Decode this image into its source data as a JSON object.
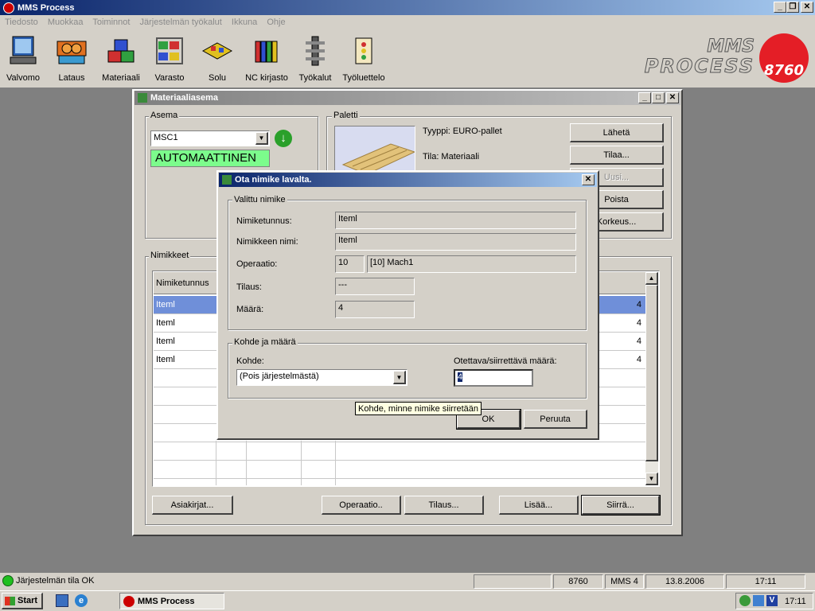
{
  "app": {
    "title": "MMS Process"
  },
  "menu": [
    "Tiedosto",
    "Muokkaa",
    "Toiminnot",
    "Järjestelmän työkalut",
    "Ikkuna",
    "Ohje"
  ],
  "toolbar": [
    {
      "label": "Valvomo",
      "icon": "monitor-icon"
    },
    {
      "label": "Lataus",
      "icon": "loading-station-icon"
    },
    {
      "label": "Materiaali",
      "icon": "material-boxes-icon"
    },
    {
      "label": "Varasto",
      "icon": "warehouse-shelf-icon"
    },
    {
      "label": "Solu",
      "icon": "cell-icon"
    },
    {
      "label": "NC kirjasto",
      "icon": "nc-library-icon"
    },
    {
      "label": "Työkalut",
      "icon": "tool-rack-icon"
    },
    {
      "label": "Työluettelo",
      "icon": "work-list-icon"
    }
  ],
  "logo": {
    "line1": "MMS",
    "line2": "PROCESS",
    "badge": "8760",
    "color": "#e41e26"
  },
  "station_window": {
    "title": "Materiaaliasema",
    "asema": {
      "label": "Asema",
      "station": "MSC1",
      "mode": "AUTOMAATTINEN"
    },
    "paletti": {
      "label": "Paletti",
      "type": "Tyyppi: EURO-pallet",
      "state": "Tila: Materiaali"
    },
    "buttons": {
      "send": "Lähetä",
      "order": "Tilaa...",
      "new": "Uusi...",
      "remove": "Poista",
      "height": "Korkeus..."
    },
    "nimikkeet": {
      "label": "Nimikkeet",
      "column_header": "Nimiketunnus",
      "rows": [
        {
          "id": "Iteml",
          "qty": "4"
        },
        {
          "id": "Iteml",
          "qty": "4"
        },
        {
          "id": "Iteml",
          "qty": "4"
        },
        {
          "id": "Iteml",
          "qty": "4"
        }
      ]
    },
    "bottom_buttons": {
      "docs": "Asiakirjat...",
      "operation": "Operaatio..",
      "order": "Tilaus...",
      "add": "Lisää...",
      "move": "Siirrä..."
    }
  },
  "dialog": {
    "title": "Ota nimike lavalta.",
    "selected_group": "Valittu nimike",
    "item_id_label": "Nimiketunnus:",
    "item_id": "Iteml",
    "item_name_label": "Nimikkeen nimi:",
    "item_name": "Iteml",
    "operation_label": "Operaatio:",
    "operation_no": "10",
    "operation_name": "[10] Mach1",
    "order_label": "Tilaus:",
    "order": "---",
    "qty_label": "Määrä:",
    "qty": "4",
    "target_group": "Kohde ja määrä",
    "target_label": "Kohde:",
    "target_value": "(Pois järjestelmästä)",
    "take_qty_label": "Otettava/siirrettävä määrä:",
    "take_qty": "4",
    "tooltip": "Kohde, minne nimike siirretään",
    "ok": "OK",
    "cancel": "Peruuta"
  },
  "statusbar": {
    "status": "Järjestelmän tila OK",
    "code": "8760",
    "system": "MMS 4",
    "date": "13.8.2006",
    "time": "17:11"
  },
  "taskbar": {
    "start": "Start",
    "task": "MMS Process",
    "clock": "17:11"
  }
}
